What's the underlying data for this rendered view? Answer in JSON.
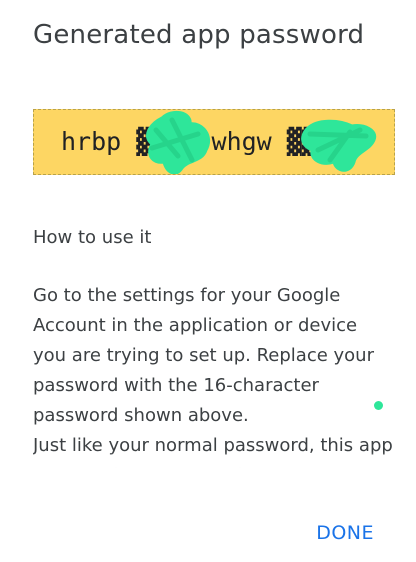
{
  "dialog": {
    "title": "Generated app password",
    "password": "hrbp ▓▓▓▓ whgw ▓▓▓▓",
    "section_heading": "How to use it",
    "instructions": "Go to the settings for your Google Account in the application or device you are trying to set up. Replace your password with the 16-character password shown above.\nJust like your normal password, this app password grants complete",
    "done_label": "DONE"
  },
  "colors": {
    "password_background": "#fdd663",
    "accent": "#1a73e8",
    "text": "#3c4043",
    "redaction_marker": "#2ee69a"
  }
}
